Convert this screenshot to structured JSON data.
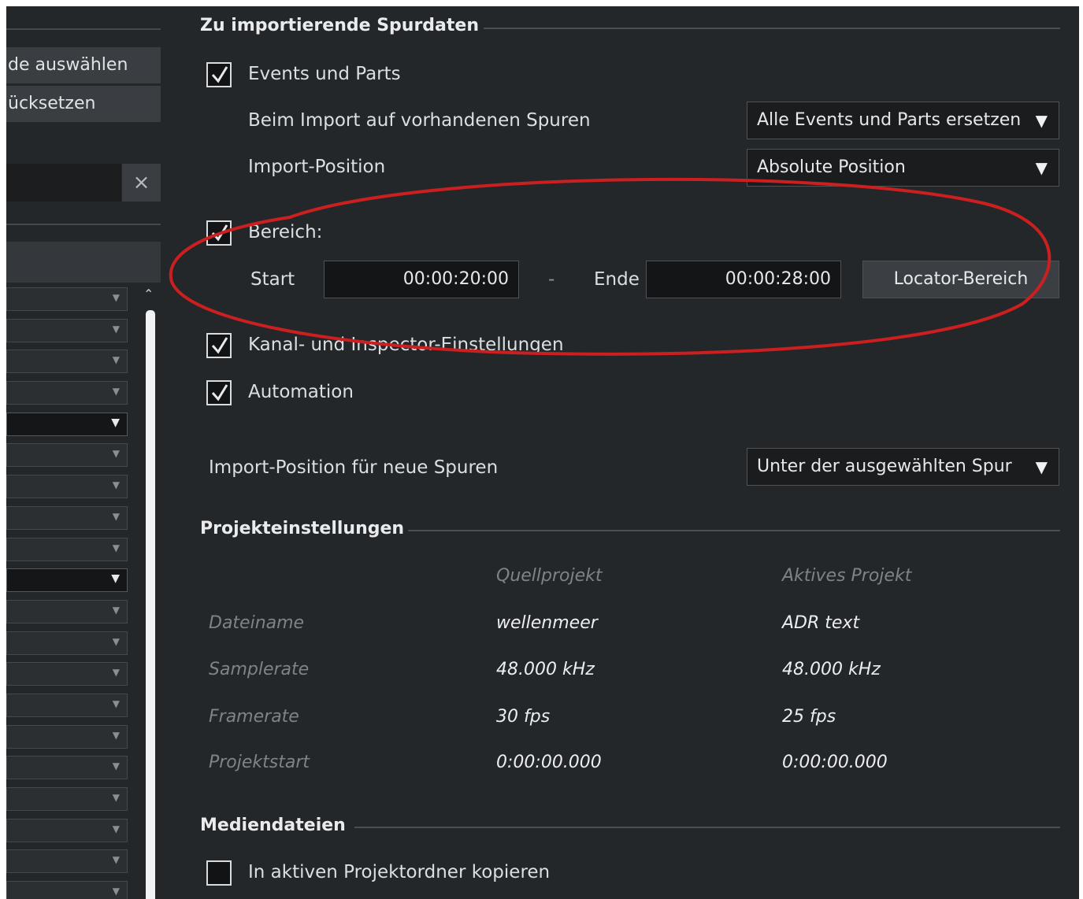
{
  "left_panel": {
    "select_label": "de auswählen",
    "reset_label": "ücksetzen",
    "search_clear_icon": "×",
    "row_count": 20,
    "dark_rows": [
      4,
      9
    ]
  },
  "track_data": {
    "title": "Zu importierende Spurdaten",
    "events_parts": {
      "label": "Events und Parts",
      "checked": true
    },
    "import_existing": {
      "label": "Beim Import auf vorhandenen Spuren",
      "value": "Alle Events und Parts ersetzen"
    },
    "import_position": {
      "label": "Import-Position",
      "value": "Absolute Position"
    },
    "range": {
      "label": "Bereich:",
      "checked": true,
      "start_label": "Start",
      "start_value": "00:00:20:00",
      "separator": "-",
      "end_label": "Ende",
      "end_value": "00:00:28:00",
      "locator_button": "Locator-Bereich"
    },
    "channel_inspector": {
      "label": "Kanal- und Inspector-Einstellungen",
      "checked": true
    },
    "automation": {
      "label": "Automation",
      "checked": true
    },
    "new_track_position": {
      "label": "Import-Position für neue Spuren",
      "value": "Unter der ausgewählten Spur"
    }
  },
  "project_settings": {
    "title": "Projekteinstellungen",
    "col_source": "Quellprojekt",
    "col_active": "Aktives Projekt",
    "rows": [
      {
        "label": "Dateiname",
        "source": "wellenmeer",
        "active": "ADR text"
      },
      {
        "label": "Samplerate",
        "source": "48.000 kHz",
        "active": "48.000 kHz"
      },
      {
        "label": "Framerate",
        "source": "30 fps",
        "active": "25 fps"
      },
      {
        "label": "Projektstart",
        "source": "0:00:00.000",
        "active": "0:00:00.000"
      }
    ]
  },
  "media": {
    "title": "Mediendateien",
    "copy_to_folder": {
      "label": "In aktiven Projektordner kopieren",
      "checked": false
    }
  },
  "colors": {
    "background": "#24272a",
    "annotation": "#cc1f1f"
  },
  "icons": {
    "checkbox_checked": "checkmark-icon",
    "dropdown": "triangle-down-icon"
  }
}
